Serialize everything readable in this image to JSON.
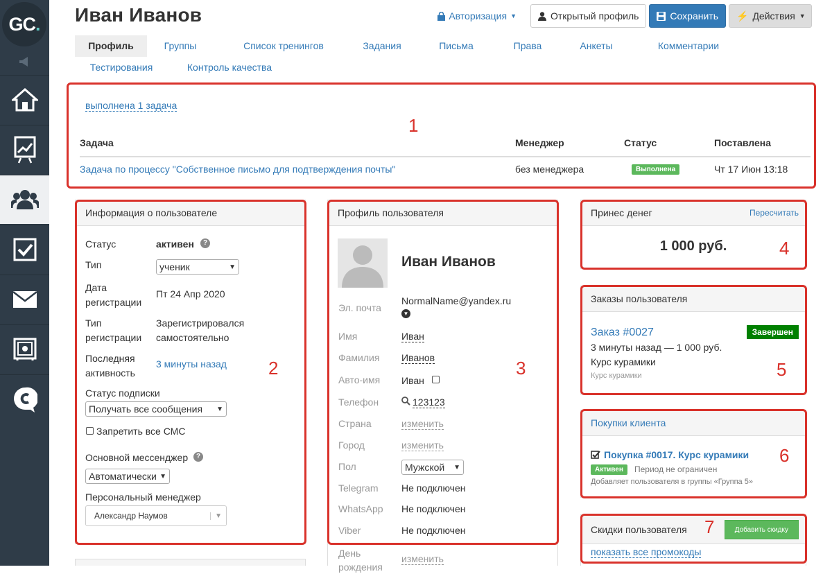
{
  "app": {
    "logo_text": "GC",
    "logo_dot": "."
  },
  "sidebar": {
    "items": [
      {
        "icon": "home-icon"
      },
      {
        "icon": "chart-icon"
      },
      {
        "icon": "users-icon",
        "active": true
      },
      {
        "icon": "checkbox-icon"
      },
      {
        "icon": "mail-icon"
      },
      {
        "icon": "safe-icon"
      },
      {
        "icon": "chat-icon"
      }
    ]
  },
  "header": {
    "title": "Иван Иванов",
    "auth": "Авторизация",
    "open_profile": "Открытый профиль",
    "save": "Сохранить",
    "actions": "Действия"
  },
  "tabs": [
    "Профиль",
    "Группы",
    "Список тренингов",
    "Задания",
    "Письма",
    "Права",
    "Анкеты",
    "Комментарии",
    "Тестирования",
    "Контроль качества"
  ],
  "tasks": {
    "link": "выполнена 1 задача",
    "headers": [
      "Задача",
      "Менеджер",
      "Статус",
      "Поставлена"
    ],
    "rows": [
      {
        "task": "Задача по процессу \"Собственное письмо для подтверждения почты\"",
        "manager": "без менеджера",
        "status": "Выполнена",
        "date": "Чт 17 Июн 13:18"
      }
    ]
  },
  "info": {
    "title": "Информация о пользователе",
    "status_label": "Статус",
    "status_value": "активен",
    "type_label": "Тип",
    "type_value": "ученик",
    "reg_date_label": "Дата регистрации",
    "reg_date_value": "Пт 24 Апр 2020",
    "reg_type_label": "Тип регистрации",
    "reg_type_value": "Зарегистрировался самостоятельно",
    "last_active_label": "Последняя активность",
    "last_active_value": "3 минуты назад",
    "sub_label": "Статус подписки",
    "sub_value": "Получать все сообщения",
    "sms_label": "Запретить все СМС",
    "messenger_label": "Основной мессенджер",
    "messenger_value": "Автоматически",
    "manager_label": "Персональный менеджер",
    "manager_value": "Александр Наумов"
  },
  "profile": {
    "title": "Профиль пользователя",
    "name": "Иван Иванов",
    "email_label": "Эл. почта",
    "email_value": "NormalName@yandex.ru",
    "first_label": "Имя",
    "first_value": "Иван",
    "last_label": "Фамилия",
    "last_value": "Иванов",
    "auto_label": "Авто-имя",
    "auto_value": "Иван",
    "phone_label": "Телефон",
    "phone_value": "123123",
    "country_label": "Страна",
    "country_value": "изменить",
    "city_label": "Город",
    "city_value": "изменить",
    "gender_label": "Пол",
    "gender_value": "Мужской",
    "telegram_label": "Telegram",
    "telegram_value": "Не подключен",
    "whatsapp_label": "WhatsApp",
    "whatsapp_value": "Не подключен",
    "viber_label": "Viber",
    "viber_value": "Не подключен",
    "birthday_label": "День рождения",
    "birthday_value": "изменить"
  },
  "money": {
    "title": "Принес денег",
    "recalc": "Пересчитать",
    "amount": "1 000 руб."
  },
  "orders": {
    "title": "Заказы пользователя",
    "order": "Заказ #0027",
    "status": "Завершен",
    "meta": "3 минуты назад — 1 000 руб.",
    "course": "Курс курамики",
    "sub": "Курс курамики"
  },
  "purchases": {
    "title": "Покупки клиента",
    "purchase": "Покупка #0017. Курс курамики",
    "badge": "Активен",
    "period": "Период не ограничен",
    "note": "Добавляет пользователя в группы «Группа 5»"
  },
  "discounts": {
    "title": "Скидки пользователя",
    "add": "Добавить скидку",
    "show": "показать все промокоды"
  },
  "annotations": [
    "1",
    "2",
    "3",
    "4",
    "5",
    "6",
    "7"
  ],
  "colors": {
    "sidebar": "#2f3c48",
    "link": "#337ab7",
    "primary": "#337ab7",
    "success": "#5cb85c",
    "dark_success": "#008000",
    "highlight": "#d9322b"
  }
}
